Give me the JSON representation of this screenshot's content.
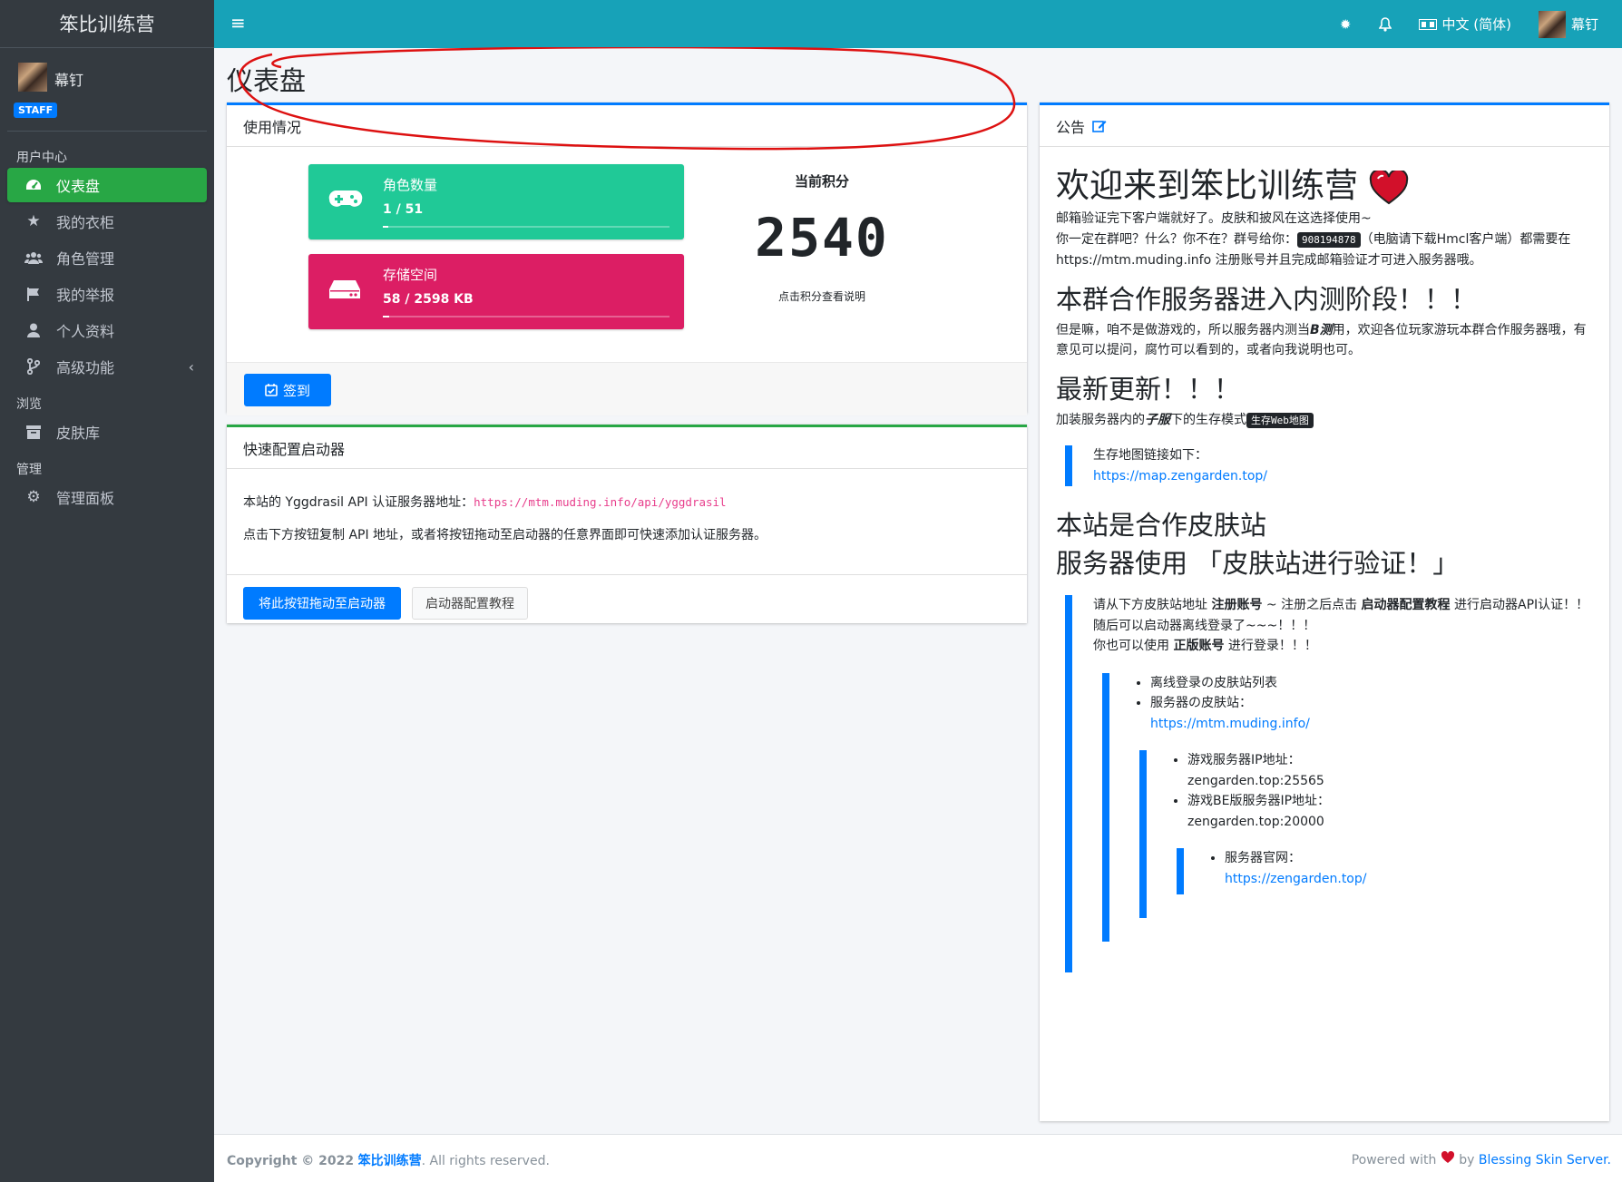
{
  "app": {
    "brand": "笨比训练营"
  },
  "user": {
    "name": "幕钉",
    "role_badge": "STAFF"
  },
  "sidebar": {
    "sections": [
      {
        "header": "用户中心"
      },
      {
        "header": "浏览"
      },
      {
        "header": "管理"
      }
    ],
    "items": [
      {
        "label": "仪表盘",
        "icon": "dashboard-icon"
      },
      {
        "label": "我的衣柜",
        "icon": "star-icon"
      },
      {
        "label": "角色管理",
        "icon": "users-icon"
      },
      {
        "label": "我的举报",
        "icon": "flag-icon"
      },
      {
        "label": "个人资料",
        "icon": "user-icon"
      },
      {
        "label": "高级功能",
        "icon": "code-branch-icon"
      },
      {
        "label": "皮肤库",
        "icon": "archive-icon"
      },
      {
        "label": "管理面板",
        "icon": "gear-icon"
      }
    ]
  },
  "topbar": {
    "menu_icon": "hamburger-icon",
    "language": "中文 (简体)",
    "username": "幕钉"
  },
  "page": {
    "title": "仪表盘"
  },
  "usage": {
    "header": "使用情况",
    "characters": {
      "label": "角色数量",
      "value": "1 / 51",
      "ratio": 0.02
    },
    "storage": {
      "label": "存储空间",
      "value": "58 / 2598 KB",
      "ratio": 0.022
    },
    "score": {
      "label": "当前积分",
      "value": "2540",
      "hint": "点击积分查看说明"
    },
    "checkin_label": "签到"
  },
  "quick": {
    "header": "快速配置启动器",
    "api_prefix": "本站的 Yggdrasil API 认证服务器地址：",
    "api_url": "https://mtm.muding.info/api/yggdrasil",
    "instructions": "点击下方按钮复制 API 地址，或者将按钮拖动至启动器的任意界面即可快速添加认证服务器。",
    "drag_button": "将此按钮拖动至启动器",
    "tutorial_button": "启动器配置教程"
  },
  "notice": {
    "header": "公告",
    "welcome_title": "欢迎来到笨比训练营",
    "welcome_line1": "邮箱验证完下客户端就好了。皮肤和披风在这选择使用~",
    "welcome_line2a": "你一定在群吧？什么？你不在？群号给你：",
    "group_number": "908194878",
    "welcome_line2b": "（电脑请下载Hmcl客户端）都需要在https://mtm.muding.info 注册账号并且完成邮箱验证才可进入服务器哦。",
    "beta_title": "本群合作服务器进入内测阶段！！！",
    "beta_text_a": "但是嘛，咱不是做游戏的，所以服务器内测当",
    "beta_text_em": "B测",
    "beta_text_b": "用，欢迎各位玩家游玩本群合作服务器哦，有意见可以提问，腐竹可以看到的，或者向我说明也可。",
    "update_title": "最新更新！！！",
    "update_text_a": "加装服务器内的",
    "update_text_em": "子服",
    "update_text_b": "下的生存模式",
    "update_badge": "生存Web地图",
    "map_label": "生存地图链接如下：",
    "map_url": "https://map.zengarden.top/",
    "coop_title_1": "本站是合作皮肤站",
    "coop_title_2": "服务器使用 「皮肤站进行验证！」",
    "coop_text_a": "请从下方皮肤站地址",
    "coop_text_b1": "注册账号",
    "coop_text_c": "~ 注册之后点击",
    "coop_text_b2": "启动器配置教程",
    "coop_text_d": "进行启动器API认证！！",
    "coop_text_e": "随后可以启动器离线登录了~~~！！！",
    "coop_text_f": "你也可以使用",
    "coop_text_b3": "正版账号",
    "coop_text_g": "进行登录！！！",
    "list1_item1": "离线登录の皮肤站列表",
    "list1_item2": "服务器の皮肤站：",
    "list1_url": "https://mtm.muding.info/",
    "list2_item1": "游戏服务器IP地址：",
    "list2_item1_val": "zengarden.top:25565",
    "list2_item2": "游戏BE版服务器IP地址：",
    "list2_item2_val": "zengarden.top:20000",
    "list3_item1": "服务器官网：",
    "list3_url": "https://zengarden.top/"
  },
  "footer": {
    "copyright": "Copyright © 2022",
    "site": "笨比训练营",
    "rights": ". All rights reserved.",
    "powered": "Powered with",
    "by": "by",
    "engine": "Blessing Skin Server."
  },
  "colors": {
    "sidebar": "#343a40",
    "topbar": "#17a2b8",
    "active": "#28a745",
    "teal": "#20c997",
    "pink": "#dc1e64",
    "primary": "#007bff"
  }
}
